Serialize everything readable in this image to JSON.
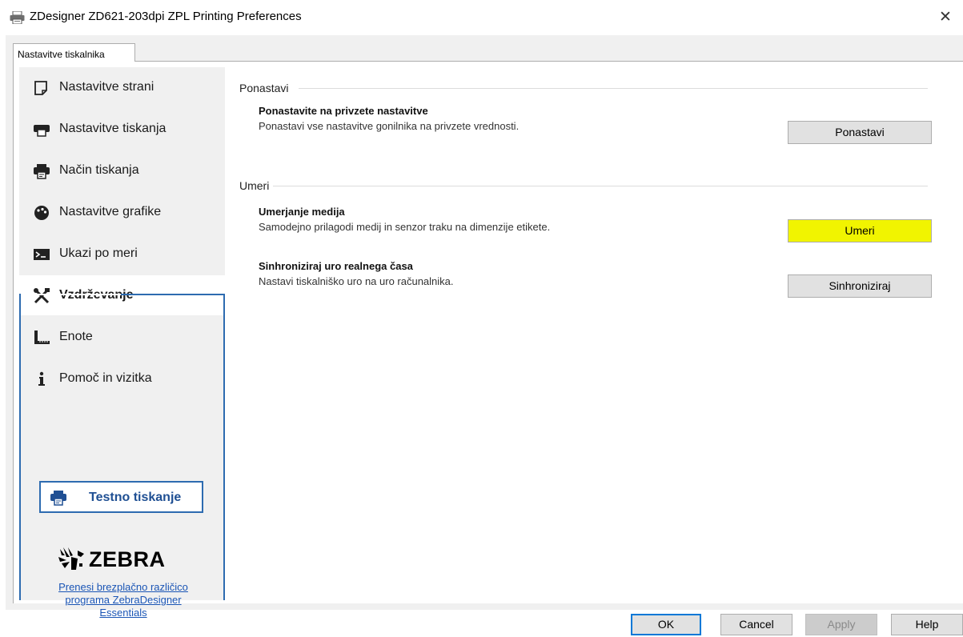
{
  "window": {
    "title": "ZDesigner ZD621-203dpi ZPL Printing Preferences",
    "close_glyph": "✕"
  },
  "tabs": [
    {
      "label": "Nastavitve tiskalnika",
      "active": true
    }
  ],
  "sidebar": {
    "items": [
      {
        "label": "Nastavitve strani",
        "icon": "page-icon"
      },
      {
        "label": "Nastavitve tiskanja",
        "icon": "printer-icon"
      },
      {
        "label": "Način tiskanja",
        "icon": "print-mode-icon"
      },
      {
        "label": "Nastavitve grafike",
        "icon": "graphics-icon"
      },
      {
        "label": "Ukazi po meri",
        "icon": "terminal-icon"
      },
      {
        "label": "Vzdrževanje",
        "icon": "tools-icon",
        "active": true
      },
      {
        "label": "Enote",
        "icon": "ruler-icon"
      },
      {
        "label": "Pomoč in vizitka",
        "icon": "info-icon"
      }
    ],
    "test_print_label": "Testno tiskanje",
    "brand_name": "ZEBRA",
    "download_link": {
      "line1": "Prenesi brezplačno različico",
      "line2": "programa ZebraDesigner",
      "line3": "Essentials"
    }
  },
  "main": {
    "reset": {
      "heading": "Ponastavi",
      "title": "Ponastavite na privzete nastavitve",
      "description": "Ponastavi vse nastavitve gonilnika na privzete vrednosti.",
      "button": "Ponastavi"
    },
    "calibrate": {
      "heading": "Umeri",
      "media_title": "Umerjanje medija",
      "media_description": "Samodejno prilagodi medij in senzor traku na dimenzije etikete.",
      "media_button": "Umeri",
      "clock_title": "Sinhroniziraj uro realnega časa",
      "clock_description": "Nastavi tiskalniško uro na uro računalnika.",
      "clock_button": "Sinhroniziraj"
    }
  },
  "footer": {
    "ok": "OK",
    "cancel": "Cancel",
    "apply": "Apply",
    "help": "Help"
  },
  "colors": {
    "accent_blue": "#2d6bb0",
    "highlight_yellow": "#f1f400",
    "sidebar_bg": "#f0f0f0"
  }
}
